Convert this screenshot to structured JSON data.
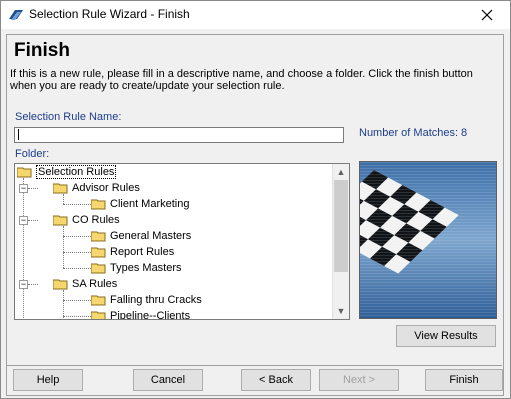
{
  "window": {
    "title": "Selection Rule Wizard - Finish",
    "close_icon": "close-icon"
  },
  "page": {
    "title": "Finish",
    "description": "If this is a new rule, please fill in a descriptive name, and choose a folder.  Click the finish button when you are ready to create/update your selection rule."
  },
  "form": {
    "name_label": "Selection Rule Name:",
    "name_value": "",
    "matches_label": "Number of Matches:",
    "matches_value": "8",
    "folder_label": "Folder:"
  },
  "tree": {
    "root": "Selection Rules",
    "advisor": "Advisor Rules",
    "client_marketing": "Client Marketing",
    "co": "CO Rules",
    "general_masters": "General Masters",
    "report_rules": "Report Rules",
    "types_masters": "Types Masters",
    "sa": "SA Rules",
    "falling": "Falling thru Cracks",
    "pipeline": "Pipeline--Clients"
  },
  "buttons": {
    "view_results": "View Results",
    "help": "Help",
    "cancel": "Cancel",
    "back": "< Back",
    "next": "Next >",
    "finish": "Finish"
  },
  "colors": {
    "label_blue": "#1c3d8c",
    "folder_yellow": "#f5d76e"
  }
}
